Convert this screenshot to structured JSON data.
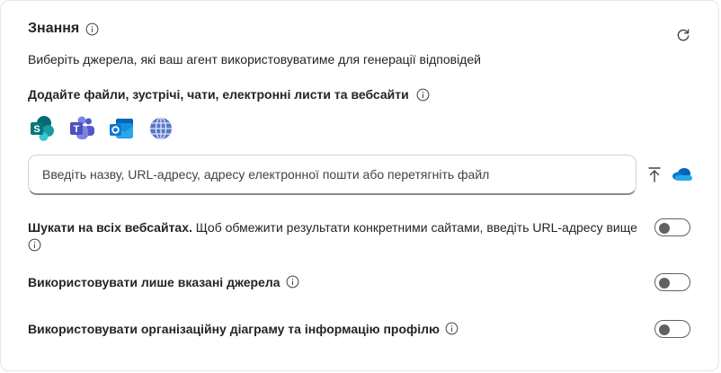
{
  "knowledge": {
    "title": "Знання",
    "subtitle": "Виберіть джерела, які ваш агент використовуватиме для генерації відповідей",
    "sources_title": "Додайте файли, зустрічі, чати, електронні листи та вебсайти",
    "apps": [
      {
        "name": "SharePoint",
        "icon": "sharepoint-icon"
      },
      {
        "name": "Teams",
        "icon": "teams-icon"
      },
      {
        "name": "Outlook",
        "icon": "outlook-icon"
      },
      {
        "name": "Web",
        "icon": "globe-icon"
      }
    ],
    "search": {
      "placeholder": "Введіть назву, URL-адресу, адресу електронної пошти або перетягніть файл",
      "value": ""
    },
    "options": [
      {
        "bold": "Шукати на всіх вебсайтах.",
        "text": " Щоб обмежити результати конкретними сайтами, введіть URL-адресу вище",
        "enabled": false
      },
      {
        "bold": "Використовувати лише вказані джерела",
        "text": "",
        "enabled": false
      },
      {
        "bold": "Використовувати організаційну діаграму та інформацію профілю",
        "text": "",
        "enabled": false
      }
    ]
  },
  "colors": {
    "toggle_off": "#616161",
    "border": "#d1d1d1",
    "text": "#242424"
  }
}
